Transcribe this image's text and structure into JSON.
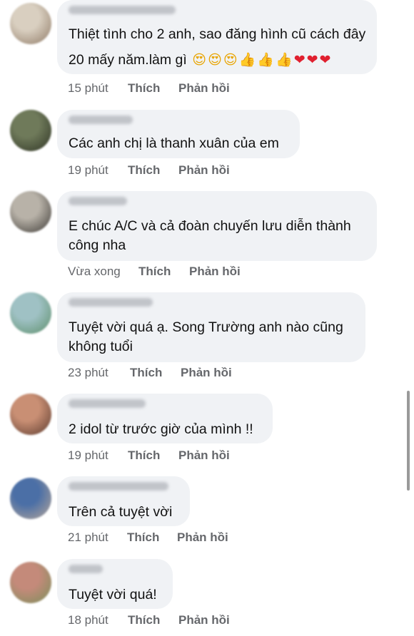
{
  "comments": [
    {
      "avatar_colors": [
        "#d9cfc0",
        "#8f7a66"
      ],
      "lines": [
        "Thiệt tình cho 2 anh, sao đăng hình cũ cách đây",
        "20 mấy năm.làm gì"
      ],
      "emojis": [
        {
          "char": "😍",
          "kind": "face"
        },
        {
          "char": "😍",
          "kind": "face"
        },
        {
          "char": "😍",
          "kind": "face"
        },
        {
          "char": "👍",
          "kind": "thumb"
        },
        {
          "char": "👍",
          "kind": "thumb"
        },
        {
          "char": "👍",
          "kind": "thumb"
        },
        {
          "char": "❤",
          "kind": "heart"
        },
        {
          "char": "❤",
          "kind": "heart"
        },
        {
          "char": "❤",
          "kind": "heart"
        }
      ],
      "time": "15 phút",
      "like": "Thích",
      "reply": "Phản hồi"
    },
    {
      "avatar_colors": [
        "#6f7a5a",
        "#2e3324"
      ],
      "lines": [
        "Các anh chị là thanh xuân của em"
      ],
      "time": "19 phút",
      "like": "Thích",
      "reply": "Phản hồi"
    },
    {
      "avatar_colors": [
        "#b8b2a8",
        "#3d3a36"
      ],
      "lines": [
        "E chúc A/C và cả đoàn chuyến lưu diễn thành",
        "công nha"
      ],
      "time": "Vừa xong",
      "like": "Thích",
      "reply": "Phản hồi"
    },
    {
      "avatar_colors": [
        "#9fc1c4",
        "#5d8f6a"
      ],
      "lines": [
        "Tuyệt vời quá ạ. Song Trường anh nào cũng",
        "không tuổi"
      ],
      "time": "23 phút",
      "like": "Thích",
      "reply": "Phản hồi"
    },
    {
      "avatar_colors": [
        "#c98f74",
        "#5b3a2e"
      ],
      "lines": [
        "2 idol từ trước giờ của mình !!"
      ],
      "time": "19 phút",
      "like": "Thích",
      "reply": "Phản hồi"
    },
    {
      "avatar_colors": [
        "#4b6fa6",
        "#b7a79a"
      ],
      "lines": [
        "Trên cả tuyệt vời"
      ],
      "time": "21 phút",
      "like": "Thích",
      "reply": "Phản hồi"
    },
    {
      "avatar_colors": [
        "#c48a7a",
        "#7a8f5a"
      ],
      "lines": [
        "Tuyệt vời quá!"
      ],
      "time": "18 phút",
      "like": "Thích",
      "reply": "Phản hồi"
    }
  ]
}
